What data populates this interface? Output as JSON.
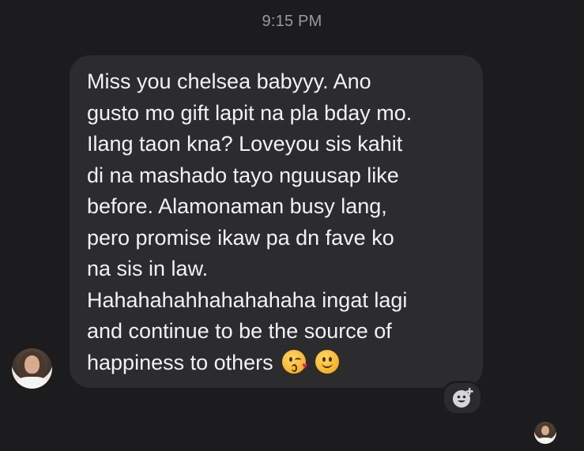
{
  "conversation": {
    "timestamp": "9:15 PM",
    "message": {
      "lines": [
        "Miss you chelsea babyyy. Ano",
        "gusto mo gift lapit na pla bday mo.",
        "Ilang taon kna? Loveyou sis kahit",
        "di na mashado tayo nguusap like",
        "before. Alamonaman busy lang,",
        "pero promise ikaw pa dn fave ko",
        "na sis in law.",
        "Hahahahahhahahahaha ingat lagi",
        "and continue to be the source of",
        "happiness to others"
      ],
      "emojis": [
        "face-blowing-kiss-emoji",
        "slightly-smiling-face-emoji"
      ]
    },
    "icons": {
      "reaction": "add-reaction-icon",
      "sender_avatar": "avatar",
      "read_receipt": "read-receipt-avatar"
    }
  }
}
